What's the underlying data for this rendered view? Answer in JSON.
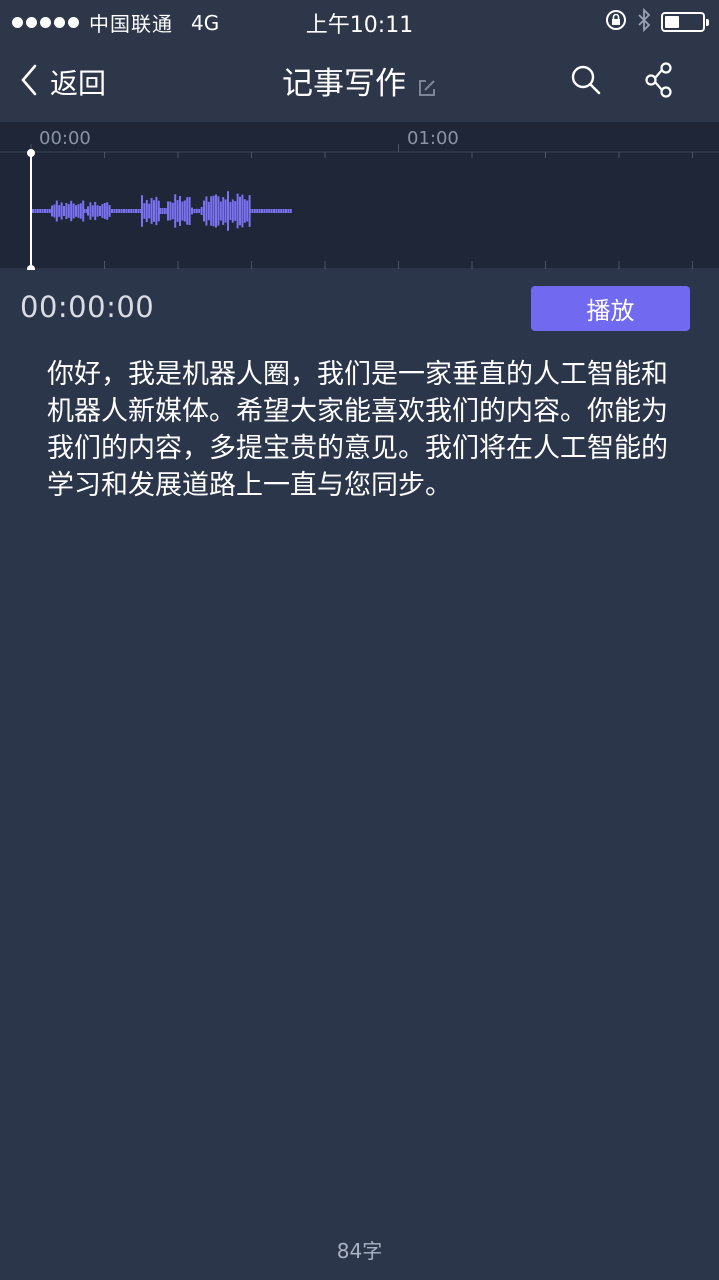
{
  "status_bar": {
    "carrier": "中国联通",
    "network": "4G",
    "time": "上午10:11",
    "battery_level": 0.4
  },
  "nav": {
    "back_label": "返回",
    "title": "记事写作"
  },
  "timeline": {
    "markers": [
      "00:00",
      "01:00"
    ]
  },
  "player": {
    "current_time": "00:00:00",
    "play_label": "播放"
  },
  "content": {
    "text": "你好，我是机器人圈，我们是一家垂直的人工智能和机器人新媒体。希望大家能喜欢我们的内容。你能为我们的内容，多提宝贵的意见。我们将在人工智能的学习和发展道路上一直与您同步。"
  },
  "footer": {
    "char_count": "84字"
  },
  "colors": {
    "background": "#2b364b",
    "timeline_bg": "#1e2637",
    "accent": "#7169f0",
    "waveform": "#7a72f2"
  }
}
